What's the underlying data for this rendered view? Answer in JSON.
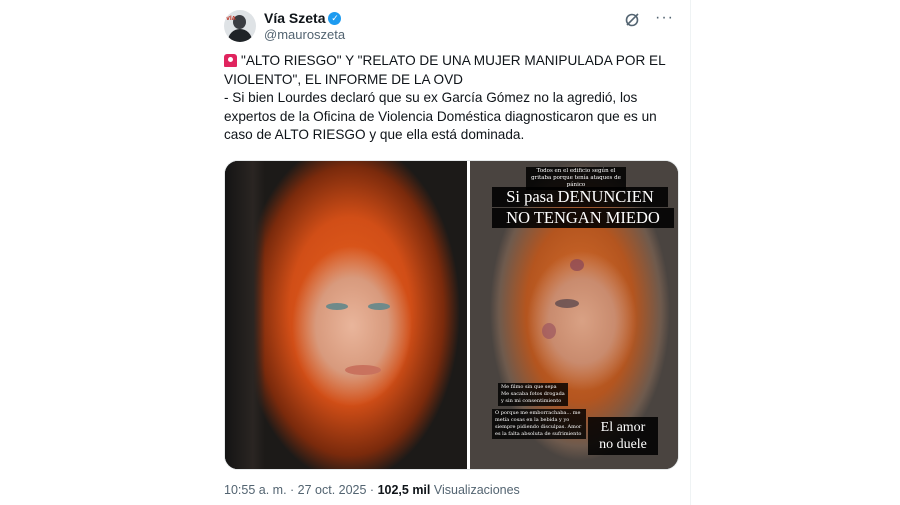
{
  "author": {
    "display_name": "Vía Szeta",
    "handle": "@mauroszeta",
    "avatar_icon": "profile-photo",
    "verified_color": "#1d9bf0"
  },
  "tweet": {
    "line1": "\"ALTO RIESGO\" Y \"RELATO DE UNA MUJER MANIPULADA POR EL VIOLENTO\", EL INFORME DE LA OVD",
    "line2": "- Si bien Lourdes declaró que su ex García Gómez no la agredió, los expertos de la Oficina de Violencia Doméstica diagnosticaron que es un caso de ALTO RIESGO y que ella está dominada."
  },
  "media": {
    "right_photo": {
      "tiny_caption": "Todos en el edificio según el gritaba porque tenía ataques de pánico",
      "big_caption_line1": "Si pasa DENUNCIEN",
      "big_caption_line2": "NO TENGAN MIEDO",
      "note1": "Me filmo sin que sepa Me sacaba fotos drogada y sin mi consentimiento",
      "note2": "O porque me emborrachaba... me metía cosas en la bebida y yo siempre pidiendo disculpas. Amor es la falta absoluta de sufrimiento",
      "amor_line1": "El amor",
      "amor_line2": "no duele"
    }
  },
  "meta": {
    "time": "10:55 a. m. · 27 oct. 2025 · ",
    "views_count": "102,5 mil",
    "views_label": " Visualizaciones"
  }
}
